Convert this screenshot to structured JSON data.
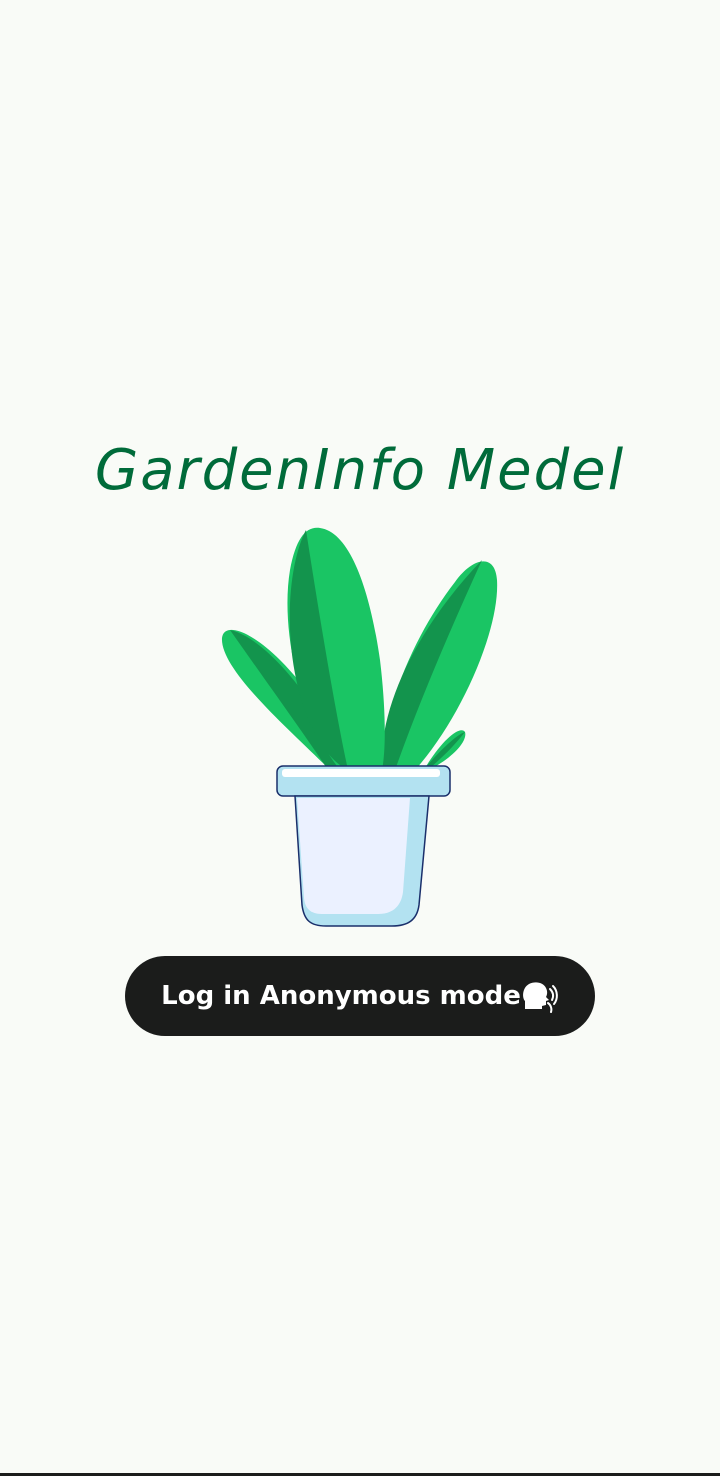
{
  "app": {
    "title": "GardenInfo Medel"
  },
  "illustration": {
    "icon": "potted-plant-icon",
    "colors": {
      "leaf_light": "#1ac564",
      "leaf_dark": "#13944d",
      "pot_body": "#ebf1ff",
      "pot_shade": "#b3e2f1",
      "pot_outline": "#1a2f6b"
    }
  },
  "login": {
    "label": "Log in Anonymous mode",
    "icon": "speaking-head-icon",
    "background": "#1b1c1b",
    "text_color": "#ffffff"
  },
  "theme": {
    "background": "#f9fbf7",
    "title_color": "#006b3a"
  }
}
